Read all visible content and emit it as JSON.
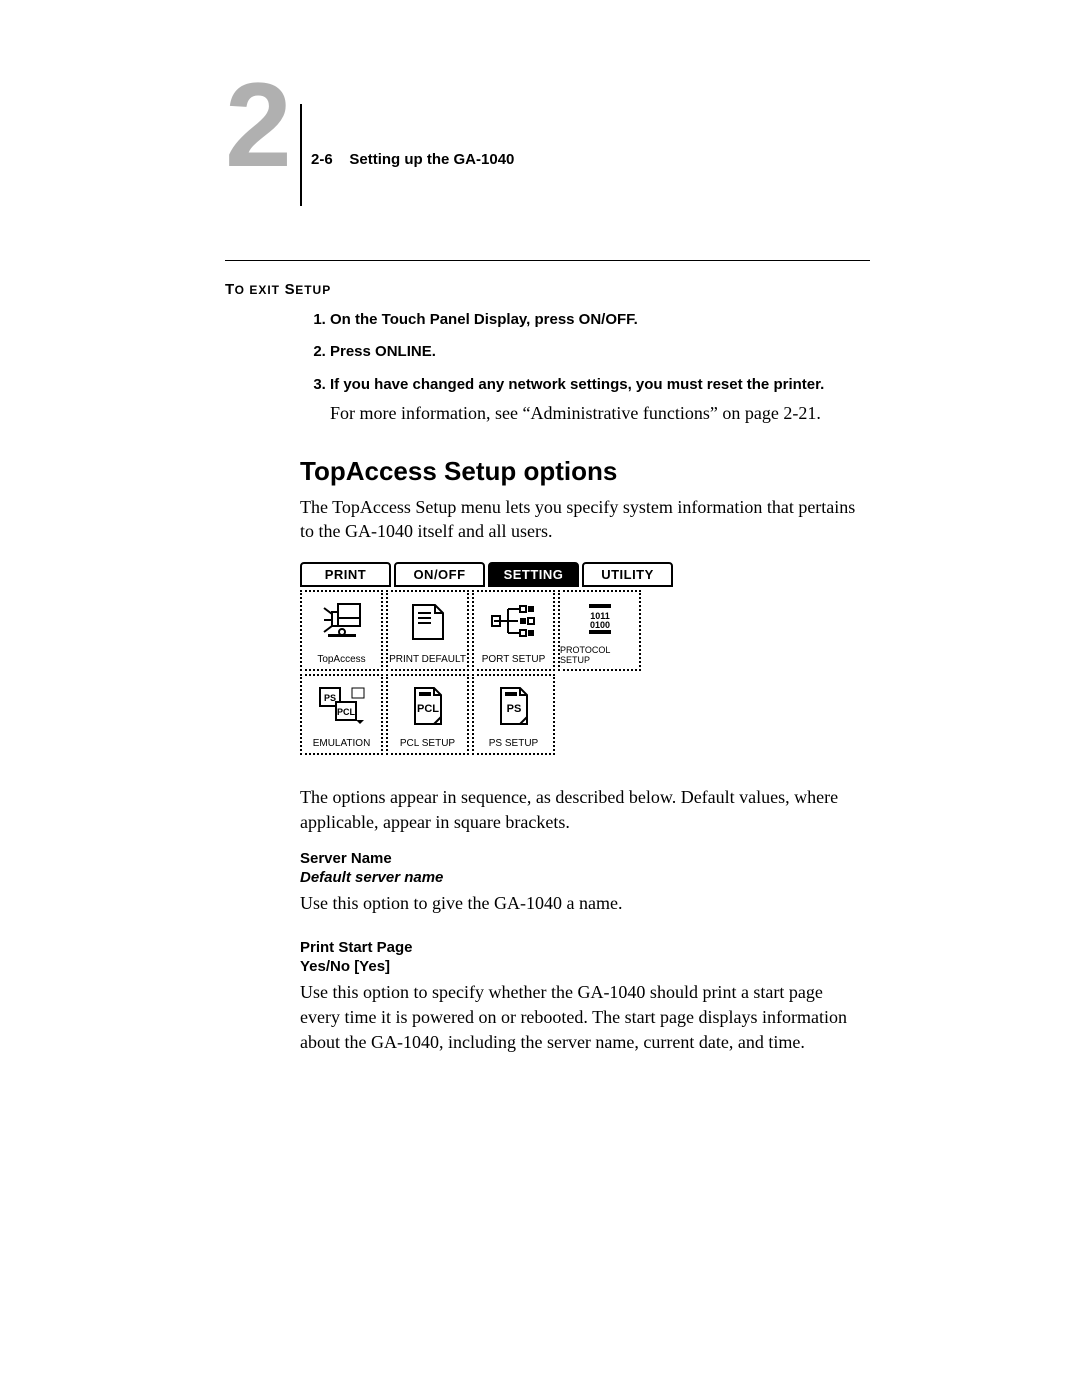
{
  "header": {
    "chapter_number": "2",
    "page_ref": "2-6",
    "running_head": "Setting up the GA-1040"
  },
  "exit_setup": {
    "title_leading": "T",
    "title_mid_sc": "O EXIT",
    "title_trail": " S",
    "title_trail_sc": "ETUP",
    "steps": [
      "On the Touch Panel Display, press ON/OFF.",
      "Press ONLINE.",
      "If you have changed any network settings, you must reset the printer."
    ],
    "step3_body": "For more information, see “Administrative functions” on page 2-21."
  },
  "section": {
    "heading": "TopAccess Setup options",
    "intro": "The TopAccess Setup menu lets you specify system information that pertains to the GA-1040 itself and all users.",
    "panel": {
      "tabs": [
        "PRINT",
        "ON/OFF",
        "SETTING",
        "UTILITY"
      ],
      "active_tab_index": 2,
      "row1": [
        "TopAccess",
        "PRINT DEFAULT",
        "PORT SETUP",
        "PROTOCOL SETUP"
      ],
      "row2": [
        "EMULATION",
        "PCL SETUP",
        "PS SETUP"
      ]
    },
    "after_panel": "The options appear in sequence, as described below. Default values, where applicable, appear in square brackets.",
    "options": [
      {
        "title": "Server Name",
        "sub": "Default server name",
        "body": "Use this option to give the GA-1040 a name."
      },
      {
        "title": "Print Start Page",
        "sub": "Yes/No [Yes]",
        "body": "Use this option to specify whether the GA-1040 should print a start page every time it is powered on or rebooted. The start page displays information about the GA-1040, including the server name, current date, and time."
      }
    ]
  }
}
